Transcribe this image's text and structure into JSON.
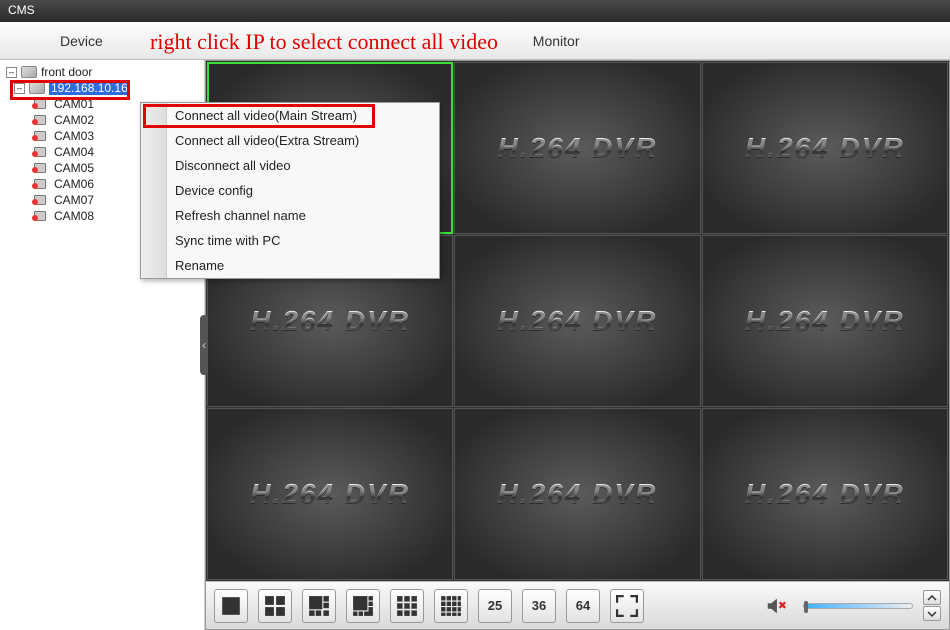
{
  "window": {
    "title": "CMS"
  },
  "toolbar": {
    "device_label": "Device",
    "monitor_label": "Monitor"
  },
  "annotation_text": "right click IP to select connect all video",
  "tree": {
    "root_label": "front door",
    "ip_label": "192.168.10.16",
    "cameras": [
      "CAM01",
      "CAM02",
      "CAM03",
      "CAM04",
      "CAM05",
      "CAM06",
      "CAM07",
      "CAM08"
    ]
  },
  "context_menu": {
    "items": [
      "Connect all video(Main Stream)",
      "Connect all video(Extra Stream)",
      "Disconnect all video",
      "Device config",
      "Refresh channel name",
      "Sync time with PC",
      "Rename"
    ]
  },
  "video": {
    "placeholder_text": "H.264 DVR"
  },
  "controls": {
    "layout_25": "25",
    "layout_36": "36",
    "layout_64": "64"
  }
}
